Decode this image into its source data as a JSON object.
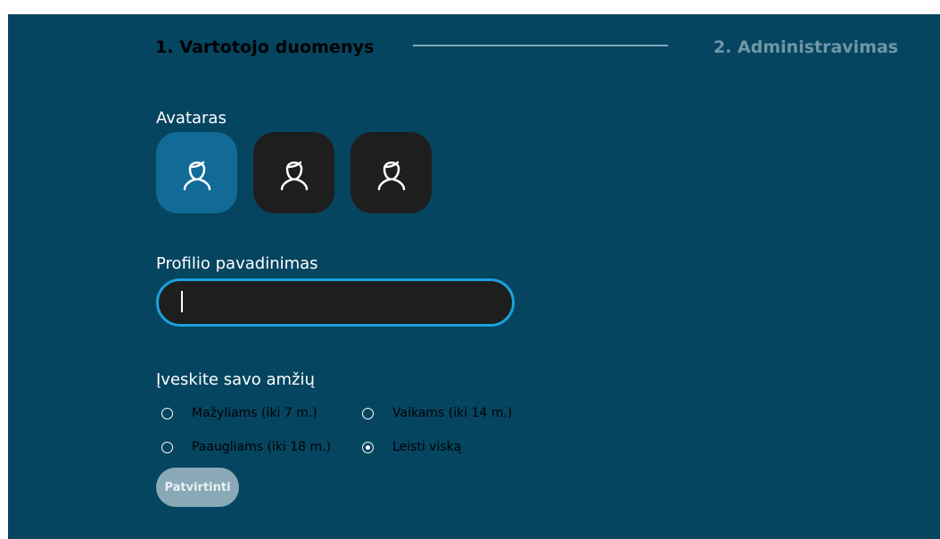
{
  "steps": {
    "step1": "1. Vartotojo duomenys",
    "step2": "2. Administravimas"
  },
  "avatar_section": {
    "label": "Avataras",
    "avatars": [
      {
        "icon": "person-icon",
        "selected": true
      },
      {
        "icon": "person-icon",
        "selected": false
      },
      {
        "icon": "person-icon",
        "selected": false
      }
    ]
  },
  "profile_name": {
    "label": "Profilio pavadinimas",
    "value": ""
  },
  "age_section": {
    "label": "Įveskite savo amžių",
    "options": [
      {
        "label": "Mažyliams (iki 7 m.)",
        "checked": false
      },
      {
        "label": "Vaikams (iki 14 m.)",
        "checked": false
      },
      {
        "label": "Paaugliams (iki 18 m.)",
        "checked": false
      },
      {
        "label": "Leisti viską",
        "checked": true
      }
    ]
  },
  "confirm_button": {
    "label": "Patvirtinti"
  },
  "colors": {
    "background": "#054560",
    "selected_avatar": "#116b96",
    "tile": "#1e1e1e",
    "focus_border": "#1aa1dd",
    "disabled_button": "#8aa9b6"
  }
}
